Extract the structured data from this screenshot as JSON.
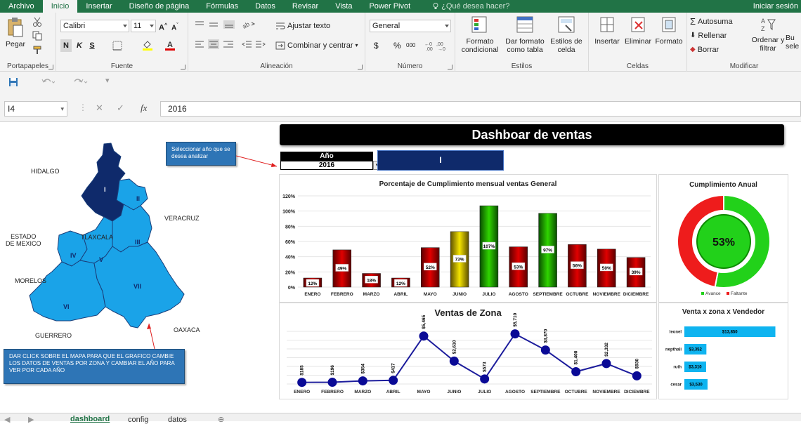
{
  "ribbon_tabs": [
    "Archivo",
    "Inicio",
    "Insertar",
    "Diseño de página",
    "Fórmulas",
    "Datos",
    "Revisar",
    "Vista",
    "Power Pivot"
  ],
  "active_tab": "Inicio",
  "tell_me": "¿Qué desea hacer?",
  "sign_in": "Iniciar sesión",
  "ribbon": {
    "portapapeles": {
      "label": "Portapapeles",
      "paste": "Pegar"
    },
    "fuente": {
      "label": "Fuente",
      "font_name": "Calibri",
      "font_size": "11",
      "bold": "N",
      "italic": "K",
      "underline": "S"
    },
    "alineacion": {
      "label": "Alineación",
      "wrap_text": "Ajustar texto",
      "merge_center": "Combinar y centrar"
    },
    "numero": {
      "label": "Número",
      "format": "General",
      "currency": "$",
      "percent": "%",
      "thousands": "000"
    },
    "estilos": {
      "label": "Estilos",
      "conditional": "Formato condicional",
      "cond_line1": "Formato",
      "cond_line2": "condicional",
      "as_table_line1": "Dar formato",
      "as_table_line2": "como tabla",
      "cell_styles_line1": "Estilos de",
      "cell_styles_line2": "celda"
    },
    "celdas": {
      "label": "Celdas",
      "insert": "Insertar",
      "delete": "Eliminar",
      "format": "Formato"
    },
    "modificar": {
      "label": "Modificar",
      "autosum": "Autosuma",
      "fill": "Rellenar",
      "clear": "Borrar",
      "sort_line1": "Ordenar y",
      "sort_line2": "filtrar",
      "find_line1": "Bu",
      "find_line2": "sele"
    }
  },
  "formula_bar": {
    "name_box": "I4",
    "fx": "fx",
    "value": "2016"
  },
  "dashboard": {
    "title": "Dashboar de ventas",
    "year_label": "Año",
    "year_value": "2016",
    "zone_value": "I",
    "callout_year": "Seleccionar año que se desea analizar",
    "callout_map": "DAR CLICK SOBRE EL MAPA PARA QUE EL GRAFICO CAMBIE LOS DATOS DE VENTAS POR ZONA Y CAMBIAR EL AÑO PARA VER POR CADA AÑO",
    "map_states": {
      "hidalgo": "HIDALGO",
      "veracruz": "VERACRUZ",
      "estado_mexico_1": "ESTADO",
      "estado_mexico_2": "DE MEXICO",
      "tlaxcala": "TLAXCALA",
      "morelos": "MORELOS",
      "guerrero": "GUERRERO",
      "oaxaca": "OAXACA"
    },
    "map_zones": [
      "I",
      "II",
      "III",
      "IV",
      "V",
      "VI",
      "VII"
    ],
    "colors": {
      "map_selected": "#0f2a6b",
      "map_other": "#1aa3e8",
      "title_bg": "#000000",
      "zone_box": "#0f2a6b",
      "callout": "#2e75b6",
      "green": "#22b14c",
      "red": "#e81818"
    }
  },
  "chart_data": [
    {
      "type": "bar",
      "title": "Porcentaje de Cumplimiento mensual  ventas General",
      "categories": [
        "ENERO",
        "FEBRERO",
        "MARZO",
        "ABRIL",
        "MAYO",
        "JUNIO",
        "JULIO",
        "AGOSTO",
        "SEPTIEMBRE",
        "OCTUBRE",
        "NOVIEMBRE",
        "DICIEMBRE"
      ],
      "values": [
        12,
        49,
        18,
        12,
        52,
        73,
        107,
        53,
        97,
        56,
        50,
        39
      ],
      "data_labels": [
        "12%",
        "49%",
        "18%",
        "12%",
        "52%",
        "73%",
        "107%",
        "53%",
        "97%",
        "56%",
        "50%",
        "39%"
      ],
      "bar_colors": [
        "red",
        "red",
        "red",
        "red",
        "red",
        "yellow",
        "green",
        "red",
        "green",
        "red",
        "red",
        "red"
      ],
      "y_ticks": [
        "0%",
        "20%",
        "40%",
        "60%",
        "80%",
        "100%",
        "120%"
      ],
      "ylim": [
        0,
        120
      ]
    },
    {
      "type": "pie",
      "title": "Cumplimiento Anual",
      "center_label": "53%",
      "slices": [
        {
          "name": "Avance",
          "value": 53,
          "color": "#22d11a"
        },
        {
          "name": "Faltante",
          "value": 47,
          "color": "#ee1c1c"
        }
      ],
      "legend": "bottom"
    },
    {
      "type": "line",
      "title": "Ventas de Zona",
      "categories": [
        "ENERO",
        "FEBRERO",
        "MARZO",
        "ABRIL",
        "MAYO",
        "JUNIO",
        "JULIO",
        "AGOSTO",
        "SEPTIEMBRE",
        "OCTUBRE",
        "NOVIEMBRE",
        "DICIEMBRE"
      ],
      "values": [
        185,
        196,
        354,
        417,
        5465,
        2610,
        573,
        5710,
        3870,
        1400,
        2332,
        930
      ],
      "data_labels": [
        "$185",
        "$196",
        "$354",
        "$417",
        "$5,465",
        "$2,610",
        "$573",
        "$5,710",
        "$3,870",
        "$1,400",
        "$2,332",
        "$930"
      ],
      "ylim": [
        0,
        6000
      ]
    },
    {
      "type": "bar",
      "orientation": "horizontal",
      "title": "Venta x zona x Vendedor",
      "categories": [
        "leonel",
        "nepthali",
        "ruth",
        "cesar"
      ],
      "values": [
        13850,
        3352,
        3310,
        3530
      ],
      "data_labels": [
        "$13,850",
        "$3,352",
        "$3,310",
        "$3,530"
      ]
    }
  ],
  "sheet_tabs": [
    "dashboard",
    "config",
    "datos"
  ],
  "active_sheet": "dashboard"
}
